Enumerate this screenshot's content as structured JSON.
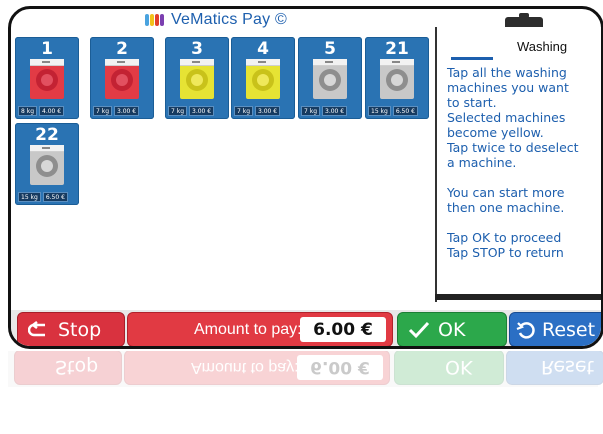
{
  "app": {
    "title": "VeMatics Pay ©",
    "logo_colors": [
      "#4aa3df",
      "#f2c21b",
      "#e2402b",
      "#7b3fb0"
    ]
  },
  "machines": [
    {
      "number": "1",
      "weight": "8 kg",
      "price": "4.00 €",
      "state": "red"
    },
    {
      "number": "2",
      "weight": "7 kg",
      "price": "3.00 €",
      "state": "red"
    },
    {
      "number": "3",
      "weight": "7 kg",
      "price": "3.00 €",
      "state": "yellow"
    },
    {
      "number": "4",
      "weight": "7 kg",
      "price": "3.00 €",
      "state": "yellow"
    },
    {
      "number": "5",
      "weight": "7 kg",
      "price": "3.00 €",
      "state": "grey"
    },
    {
      "number": "21",
      "weight": "15 kg",
      "price": "6.50 €",
      "state": "grey"
    },
    {
      "number": "22",
      "weight": "15 kg",
      "price": "6.50 €",
      "state": "grey"
    }
  ],
  "state_colors": {
    "red": {
      "body": "#e23b45",
      "drum": "#c32233",
      "inner": "#e25060"
    },
    "yellow": {
      "body": "#e6e334",
      "drum": "#c9c21a",
      "inner": "#efe85b"
    },
    "grey": {
      "body": "#c8c8c8",
      "drum": "#8e8e8e",
      "inner": "#d7d7d7"
    }
  },
  "help_panel": {
    "title": "Washing",
    "text": "Tap all the washing\nmachines you want\nto start.\nSelected machines\nbecome yellow.\nTap twice to deselect\na machine.\n\nYou can start more\nthen one machine.\n\nTap OK to proceed\nTap STOP to return"
  },
  "bottom_bar": {
    "stop_label": "Stop",
    "amount_label": "Amount to pay:",
    "amount_value": "6.00 €",
    "ok_label": "OK",
    "reset_label": "Reset"
  },
  "icons": {
    "stop": "back-arrow-icon",
    "ok": "check-icon",
    "reset": "reset-icon",
    "logo": "vematics-logo-icon"
  }
}
